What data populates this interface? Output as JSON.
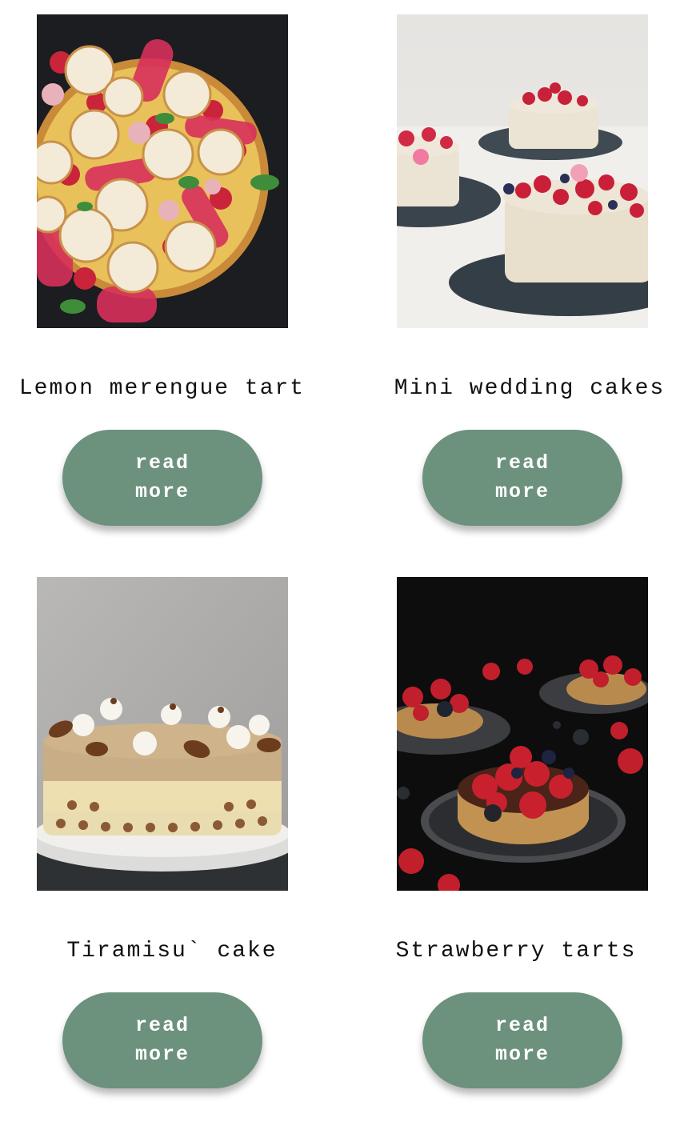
{
  "cards": [
    {
      "title": "Lemon merengue tart",
      "image": "lemon-meringue-tart-photo",
      "button_label": "read more"
    },
    {
      "title": "Mini wedding cakes",
      "image": "mini-wedding-cakes-photo",
      "button_label": "read more"
    },
    {
      "title": "Tiramisu` cake",
      "image": "tiramisu-cake-photo",
      "button_label": "read more"
    },
    {
      "title": "Strawberry tarts",
      "image": "strawberry-tarts-photo",
      "button_label": "read more"
    }
  ],
  "colors": {
    "button_background": "#6c917d",
    "button_text": "#ffffff",
    "title_text": "#111111",
    "page_background": "#ffffff"
  }
}
